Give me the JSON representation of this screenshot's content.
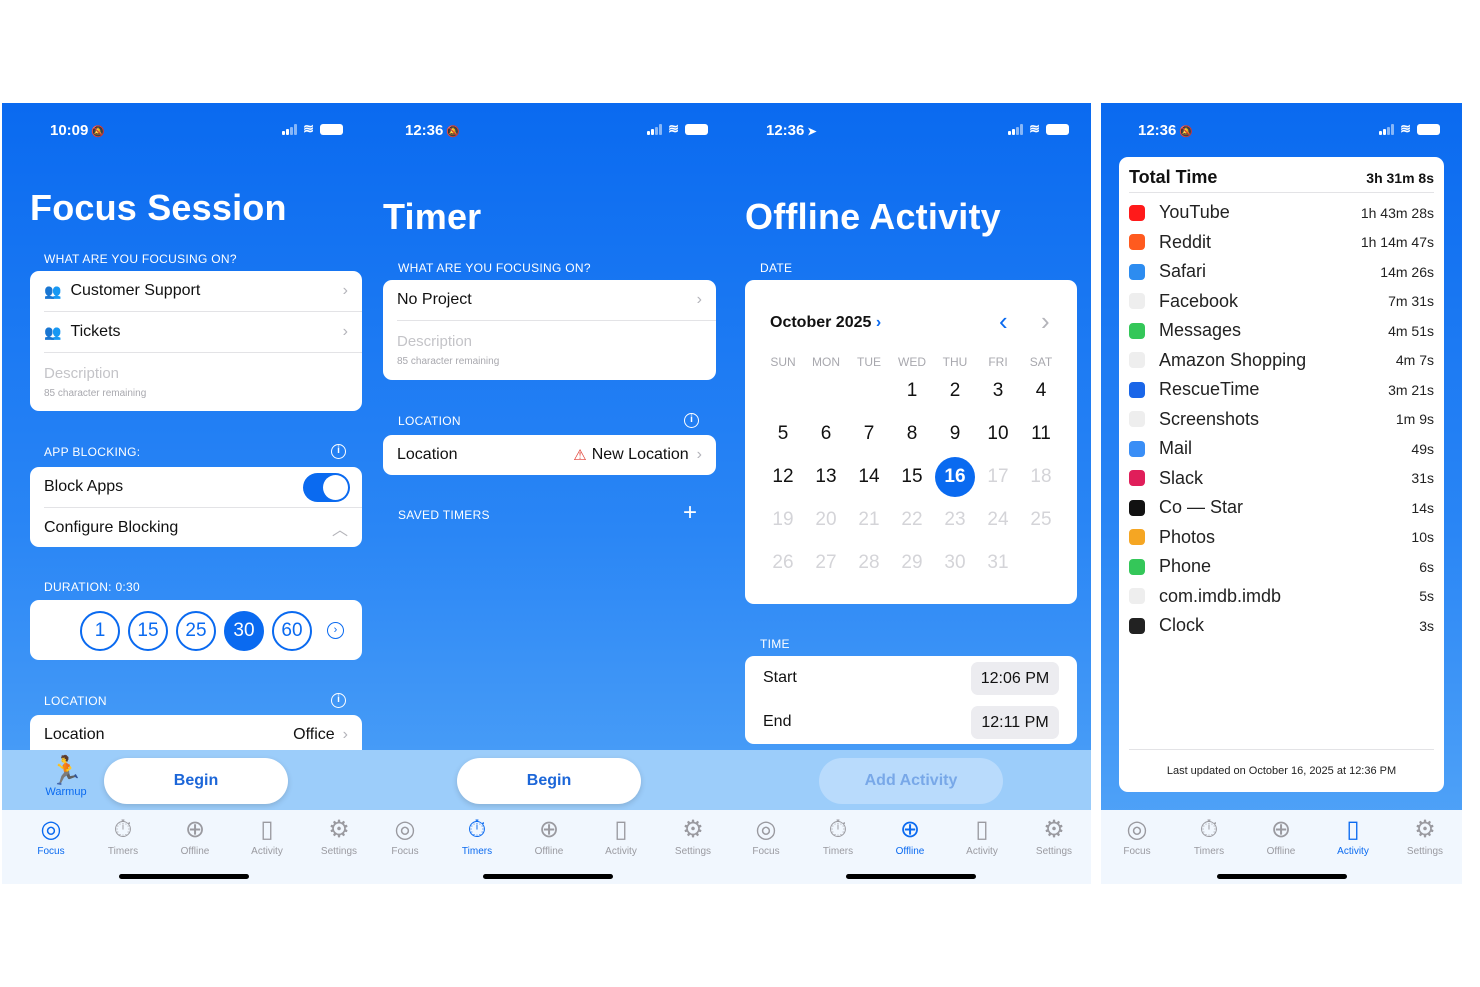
{
  "screens": {
    "focus": {
      "time": "10:09",
      "title": "Focus Session",
      "focusing_header": "WHAT ARE YOU FOCUSING ON?",
      "project": "Customer Support",
      "task": "Tickets",
      "description_placeholder": "Description",
      "description_remaining": "85 character remaining",
      "blocking_header": "APP BLOCKING:",
      "block_apps": "Block Apps",
      "configure_blocking": "Configure Blocking",
      "duration_header": "DURATION: 0:30",
      "durations": [
        "1",
        "15",
        "25",
        "30",
        "60"
      ],
      "selected_duration": "30",
      "location_header": "LOCATION",
      "location_label": "Location",
      "location_value": "Office",
      "warmup": "Warmup",
      "begin": "Begin"
    },
    "timer": {
      "time": "12:36",
      "title": "Timer",
      "focusing_header": "WHAT ARE YOU FOCUSING ON?",
      "project": "No Project",
      "description_placeholder": "Description",
      "description_remaining": "85 character remaining",
      "location_header": "LOCATION",
      "location_label": "Location",
      "location_value": "New Location",
      "saved_timers_header": "SAVED TIMERS",
      "begin": "Begin"
    },
    "offline": {
      "time": "12:36",
      "title": "Offline Activity",
      "date_header": "DATE",
      "month": "October 2025",
      "weekdays": [
        "SUN",
        "MON",
        "TUE",
        "WED",
        "THU",
        "FRI",
        "SAT"
      ],
      "selected_day": "16",
      "first_weekday": 3,
      "days_in_month": 31,
      "time_header": "TIME",
      "start_label": "Start",
      "start_value": "12:06 PM",
      "end_label": "End",
      "end_value": "12:11 PM",
      "add_activity": "Add Activity"
    },
    "activity": {
      "time": "12:36",
      "total_label": "Total Time",
      "total_value": "3h 31m 8s",
      "apps": [
        {
          "name": "YouTube",
          "duration": "1h 43m 28s",
          "color": "#ff1a1a"
        },
        {
          "name": "Reddit",
          "duration": "1h 14m 47s",
          "color": "#ff5a1f"
        },
        {
          "name": "Safari",
          "duration": "14m 26s",
          "color": "#2d8cf0"
        },
        {
          "name": "Facebook",
          "duration": "7m 31s",
          "color": "#eeeeee"
        },
        {
          "name": "Messages",
          "duration": "4m 51s",
          "color": "#34c759"
        },
        {
          "name": "Amazon Shopping",
          "duration": "4m 7s",
          "color": "#eeeeee"
        },
        {
          "name": "RescueTime",
          "duration": "3m 21s",
          "color": "#1a66e8"
        },
        {
          "name": "Screenshots",
          "duration": "1m 9s",
          "color": "#eeeeee"
        },
        {
          "name": "Mail",
          "duration": "49s",
          "color": "#3a8ef6"
        },
        {
          "name": "Slack",
          "duration": "31s",
          "color": "#e01e5a"
        },
        {
          "name": "Co — Star",
          "duration": "14s",
          "color": "#111111"
        },
        {
          "name": "Photos",
          "duration": "10s",
          "color": "#f5a623"
        },
        {
          "name": "Phone",
          "duration": "6s",
          "color": "#34c759"
        },
        {
          "name": "com.imdb.imdb",
          "duration": "5s",
          "color": "#eeeeee"
        },
        {
          "name": "Clock",
          "duration": "3s",
          "color": "#222222"
        }
      ],
      "last_updated": "Last updated on October 16, 2025 at 12:36 PM"
    }
  },
  "tabs": [
    {
      "label": "Focus",
      "icon": "target-icon",
      "glyph": "◎"
    },
    {
      "label": "Timers",
      "icon": "stopwatch-icon",
      "glyph": "⏱"
    },
    {
      "label": "Offline",
      "icon": "plus-circle-icon",
      "glyph": "⊕"
    },
    {
      "label": "Activity",
      "icon": "phone-icon",
      "glyph": "▯"
    },
    {
      "label": "Settings",
      "icon": "gear-icon",
      "glyph": "⚙"
    }
  ],
  "colors": {
    "accent": "#0a6af0",
    "background_top": "#0a6af0",
    "background_bottom": "#57a8f8"
  }
}
